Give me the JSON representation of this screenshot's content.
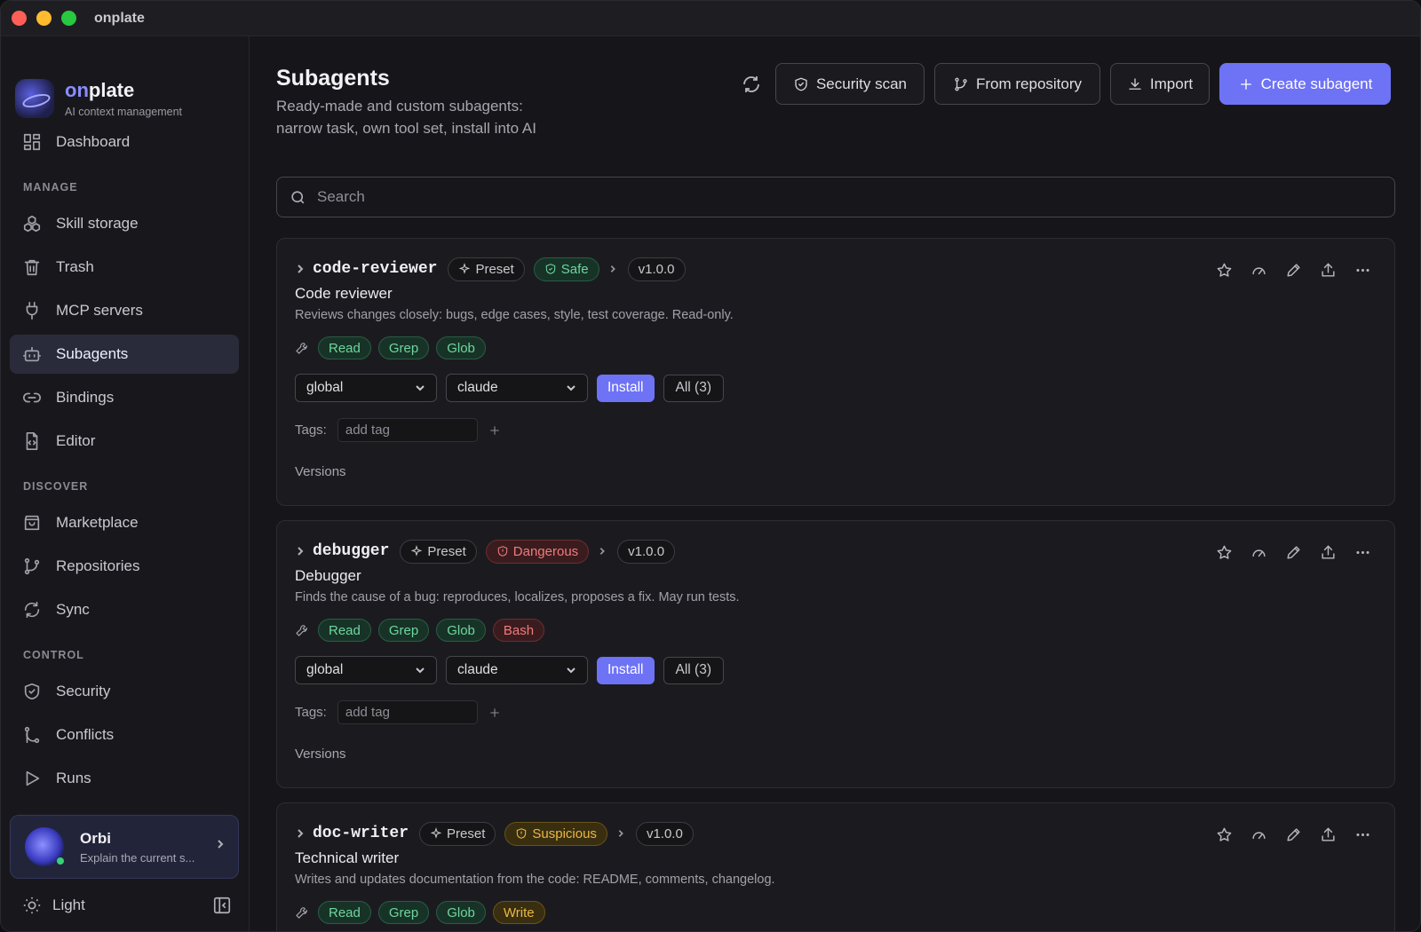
{
  "window": {
    "title": "onplate"
  },
  "brand": {
    "name_prefix": "on",
    "name_suffix": "plate",
    "subtitle": "AI context management"
  },
  "nav": {
    "dashboard": "Dashboard",
    "section_manage": "MANAGE",
    "skill_storage": "Skill storage",
    "trash": "Trash",
    "mcp_servers": "MCP servers",
    "subagents": "Subagents",
    "bindings": "Bindings",
    "editor": "Editor",
    "section_discover": "DISCOVER",
    "marketplace": "Marketplace",
    "repositories": "Repositories",
    "sync": "Sync",
    "section_control": "CONTROL",
    "security": "Security",
    "conflicts": "Conflicts",
    "runs": "Runs"
  },
  "orbi": {
    "name": "Orbi",
    "subtitle": "Explain the current s..."
  },
  "theme": {
    "label": "Light"
  },
  "header": {
    "title": "Subagents",
    "description": "Ready-made and custom subagents: narrow task, own tool set, install into AI",
    "security_scan": "Security scan",
    "from_repository": "From repository",
    "import": "Import",
    "create_subagent": "Create subagent"
  },
  "search": {
    "placeholder": "Search"
  },
  "cards": [
    {
      "id": "code-reviewer",
      "preset": "Preset",
      "status": "Safe",
      "version": "v1.0.0",
      "title": "Code reviewer",
      "description": "Reviews changes closely: bugs, edge cases, style, test coverage. Read-only.",
      "tools": [
        "Read",
        "Grep",
        "Glob"
      ],
      "scope": "global",
      "target": "claude",
      "install": "Install",
      "all": "All (3)",
      "tags_label": "Tags:",
      "tag_placeholder": "add tag",
      "versions": "Versions"
    },
    {
      "id": "debugger",
      "preset": "Preset",
      "status": "Dangerous",
      "version": "v1.0.0",
      "title": "Debugger",
      "description": "Finds the cause of a bug: reproduces, localizes, proposes a fix. May run tests.",
      "tools": [
        "Read",
        "Grep",
        "Glob",
        "Bash"
      ],
      "scope": "global",
      "target": "claude",
      "install": "Install",
      "all": "All (3)",
      "tags_label": "Tags:",
      "tag_placeholder": "add tag",
      "versions": "Versions"
    },
    {
      "id": "doc-writer",
      "preset": "Preset",
      "status": "Suspicious",
      "version": "v1.0.0",
      "title": "Technical writer",
      "description": "Writes and updates documentation from the code: README, comments, changelog.",
      "tools": [
        "Read",
        "Grep",
        "Glob",
        "Write"
      ]
    }
  ],
  "colors": {
    "accent": "#6e72f5",
    "safe": "#6fd69e",
    "danger": "#f07b7b",
    "warning": "#e8b942"
  }
}
